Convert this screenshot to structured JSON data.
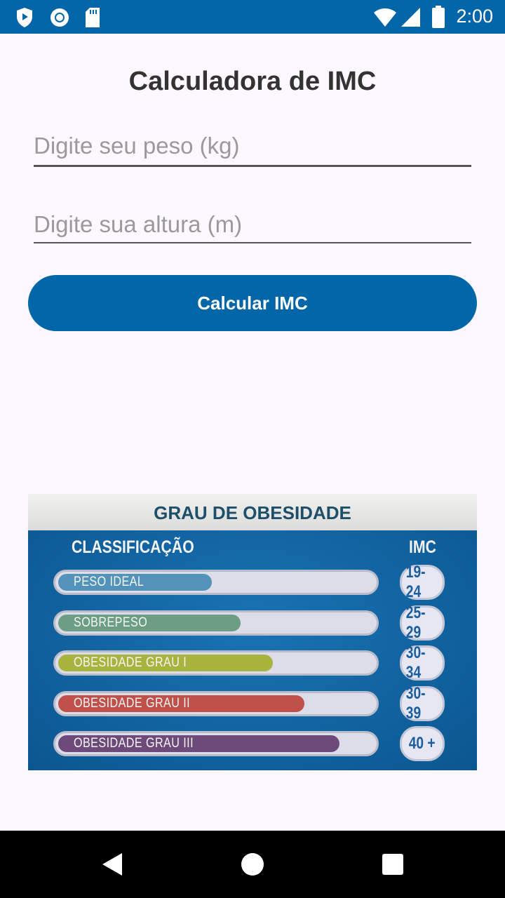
{
  "status_bar": {
    "time": "2:00",
    "icons": [
      "shield-icon",
      "circle-record-icon",
      "sd-card-icon",
      "wifi-icon",
      "signal-icon",
      "battery-icon"
    ]
  },
  "title": "Calculadora de IMC",
  "weight_input": {
    "placeholder": "Digite seu peso (kg)",
    "value": ""
  },
  "height_input": {
    "placeholder": "Digite sua altura (m)",
    "value": ""
  },
  "calc_button": {
    "label": "Calcular IMC"
  },
  "colors": {
    "primary": "#0366a8",
    "background": "#fdf7ff",
    "title_text": "#333333"
  },
  "obesity_chart": {
    "title": "GRAU DE OBESIDADE",
    "col_classification": "CLASSIFICAÇÃO",
    "col_imc": "IMC",
    "rows": [
      {
        "label": "PESO IDEAL",
        "range": "19-24",
        "color": "#5393b9",
        "level": 0.48
      },
      {
        "label": "SOBREPESO",
        "range": "25-29",
        "color": "#6c9e84",
        "level": 0.57
      },
      {
        "label": "OBESIDADE GRAU I",
        "range": "30-34",
        "color": "#a8b43e",
        "level": 0.67
      },
      {
        "label": "OBESIDADE GRAU II",
        "range": "30-39",
        "color": "#c0504a",
        "level": 0.77
      },
      {
        "label": "OBESIDADE GRAU III",
        "range": "40 +",
        "color": "#6e4a7a",
        "level": 0.88
      }
    ]
  },
  "nav_bar": {
    "icons": [
      "back-icon",
      "home-icon",
      "recents-icon"
    ]
  }
}
